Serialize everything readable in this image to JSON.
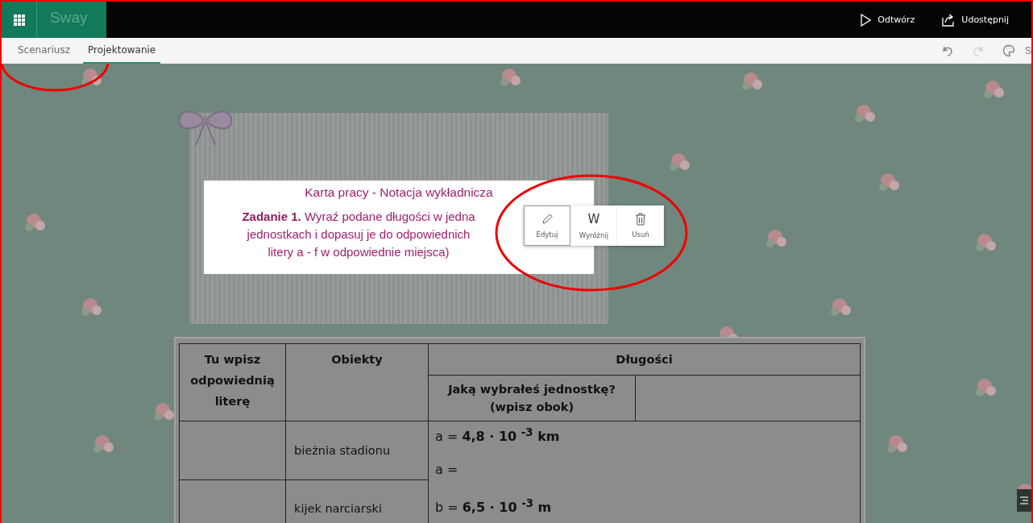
{
  "app_bar": {
    "app_name": "Sway",
    "actions": [
      {
        "kind": "play",
        "label": "Odtwórz"
      },
      {
        "kind": "share",
        "label": "Udostępnij"
      }
    ]
  },
  "tabs": [
    {
      "label": "Scenariusz",
      "selected": false
    },
    {
      "label": "Projektowanie",
      "selected": true
    }
  ],
  "toolbar_right": {
    "cut_label": "S"
  },
  "title_card": {
    "heading": "Karta pracy - Notacja wykładnicza",
    "lines": [
      "**Zadanie 1.** Wyraź podane długości w jedna",
      "jednostkach i dopasuj je do odpowiednich",
      "litery a - f w odpowiednie miejsca)"
    ]
  },
  "card_toolbar": [
    {
      "kind": "edit",
      "label": "Edytuj",
      "selected": true
    },
    {
      "kind": "emphasis",
      "glyph": "W",
      "label": "Wyróżnij",
      "selected": false
    },
    {
      "kind": "delete",
      "label": "Usuń",
      "selected": false
    }
  ],
  "table": {
    "col_letter": "Tu wpisz odpowiednią literę",
    "col_objects": "Obiekty",
    "col_lengths": "Długości",
    "unit_question": "Jaką wybrałeś jednostkę? (wpisz obok)",
    "rows": [
      {
        "object": "bieżnia stadionu"
      },
      {
        "object": "kijek narciarski"
      }
    ],
    "lengths": [
      "a = **4,8  · 10 $^{-3}$ km**",
      "a =",
      "b = **6,5 · 10 $^{-3}$ m**"
    ]
  }
}
